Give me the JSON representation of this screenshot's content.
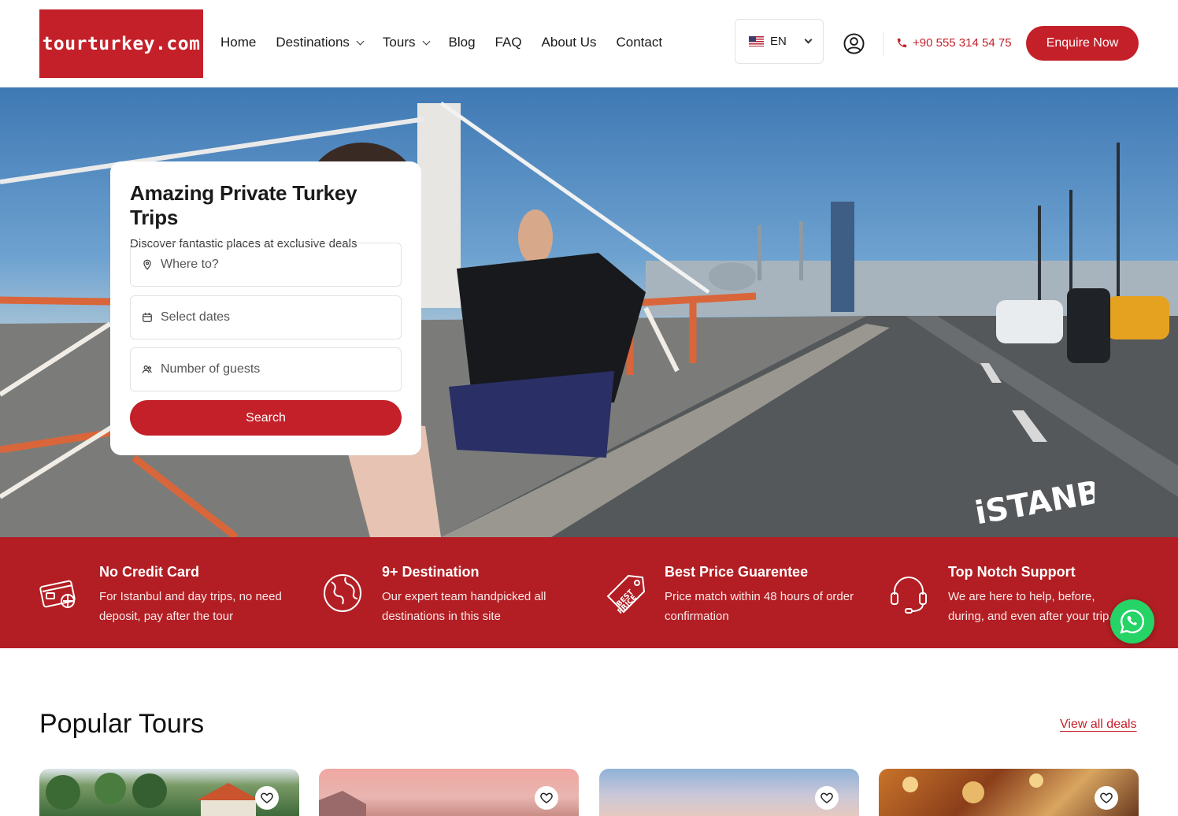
{
  "header": {
    "logo_text": "tourturkey.com",
    "nav": [
      {
        "label": "Home",
        "dropdown": false
      },
      {
        "label": "Destinations",
        "dropdown": true
      },
      {
        "label": "Tours",
        "dropdown": true
      },
      {
        "label": "Blog",
        "dropdown": false
      },
      {
        "label": "FAQ",
        "dropdown": false
      },
      {
        "label": "About Us",
        "dropdown": false
      },
      {
        "label": "Contact",
        "dropdown": false
      }
    ],
    "language": "EN",
    "phone": "+90 555 314 54 75",
    "enquire_label": "Enquire Now"
  },
  "hero": {
    "title": "Amazing Private Turkey Trips",
    "subtitle": "Discover fantastic places at exclusive deals",
    "where_placeholder": "Where to?",
    "dates_placeholder": "Select dates",
    "guests_placeholder": "Number of guests",
    "search_label": "Search",
    "overlay_text": "iSTANBUL"
  },
  "features": [
    {
      "icon": "credit-card-icon",
      "title": "No Credit Card",
      "desc": "For Istanbul and day trips, no need deposit, pay after the tour"
    },
    {
      "icon": "globe-icon",
      "title": "9+ Destination",
      "desc": "Our expert team handpicked all destinations in this site"
    },
    {
      "icon": "price-tag-icon",
      "title": "Best Price Guarentee",
      "desc": "Price match within 48 hours of order confirmation"
    },
    {
      "icon": "headset-icon",
      "title": "Top Notch Support",
      "desc": "We are here to help, before, during, and even after your trip."
    }
  ],
  "popular": {
    "title": "Popular Tours",
    "view_all": "View all deals"
  },
  "colors": {
    "brand_red": "#c4202a",
    "band_red": "#b21e23",
    "whatsapp_green": "#25d366"
  }
}
